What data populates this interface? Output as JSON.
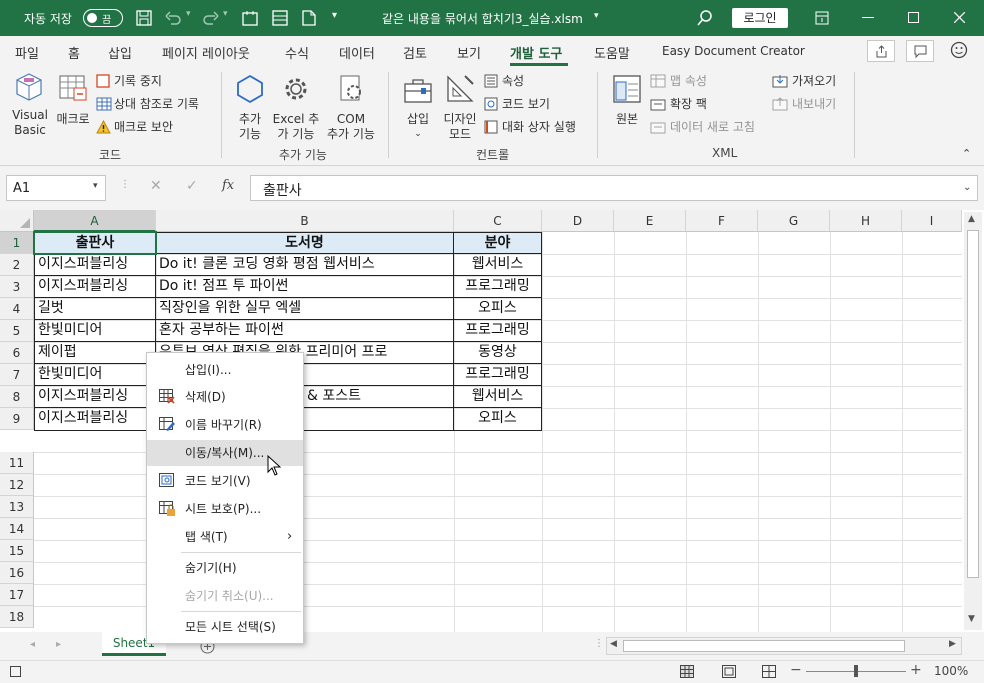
{
  "titlebar": {
    "autosave": "자동 저장",
    "toggle": "끔",
    "filename": "같은 내용을 묶어서 합치기3_실습.xlsm",
    "login": "로그인"
  },
  "tabs": [
    "파일",
    "홈",
    "삽입",
    "페이지 레이아웃",
    "수식",
    "데이터",
    "검토",
    "보기",
    "개발 도구",
    "도움말",
    "Easy Document Creator"
  ],
  "ribbon": {
    "code": {
      "vb_1": "Visual",
      "vb_2": "Basic",
      "macro": "매크로",
      "record": "기록 중지",
      "relative": "상대 참조로 기록",
      "security": "매크로 보안",
      "group": "코드"
    },
    "addins": {
      "addin_1": "추가",
      "addin_2": "기능",
      "excel_1": "Excel 추",
      "excel_2": "가 기능",
      "com_1": "COM",
      "com_2": "추가 기능",
      "group": "추가 기능"
    },
    "controls": {
      "insert": "삽입",
      "design_1": "디자인",
      "design_2": "모드",
      "props": "속성",
      "view_code": "코드 보기",
      "dialog": "대화 상자 실행",
      "group": "컨트롤"
    },
    "xml": {
      "source": "원본",
      "map_props": "맵 속성",
      "packs": "확장 팩",
      "refresh": "데이터 새로 고침",
      "import": "가져오기",
      "export": "내보내기",
      "group": "XML"
    }
  },
  "formulabar": {
    "namebox": "A1",
    "fx": "fx",
    "content": "출판사"
  },
  "columns": [
    "A",
    "B",
    "C",
    "D",
    "E",
    "F",
    "G",
    "H",
    "I"
  ],
  "rows": [
    "1",
    "2",
    "3",
    "4",
    "5",
    "6",
    "7",
    "8",
    "9",
    "11",
    "12",
    "13",
    "14",
    "15",
    "16",
    "17",
    "18"
  ],
  "table": {
    "header": [
      "출판사",
      "도서명",
      "분야"
    ],
    "data": [
      [
        "이지스퍼블리싱",
        "Do it! 클론 코딩 영화 평점 웹서비스",
        "웹서비스"
      ],
      [
        "이지스퍼블리싱",
        "Do it! 점프 투 파이썬",
        "프로그래밍"
      ],
      [
        "길벗",
        "직장인을 위한 실무 엑셀",
        "오피스"
      ],
      [
        "한빛미디어",
        "혼자 공부하는 파이썬",
        "프로그래밍"
      ],
      [
        "제이펍",
        "유튜브 영상 편집을 위한 프리미어 프로",
        "동영상"
      ],
      [
        "한빛미디어",
        "",
        "프로그래밍"
      ],
      [
        "이지스퍼블리싱",
        "& 포스트",
        "웹서비스"
      ],
      [
        "이지스퍼블리싱",
        "",
        "오피스"
      ]
    ]
  },
  "context_menu": [
    "삽입(I)...",
    "삭제(D)",
    "이름 바꾸기(R)",
    "이동/복사(M)...",
    "코드 보기(V)",
    "시트 보호(P)...",
    "탭 색(T)",
    "숨기기(H)",
    "숨기기 취소(U)...",
    "모든 시트 선택(S)"
  ],
  "sheet": {
    "tab": "Sheet1"
  },
  "status": {
    "zoom": "100%"
  },
  "colors": {
    "accent": "#217346",
    "header_fill": "#ddebf7",
    "menu_hover": "#e0e0e0"
  }
}
